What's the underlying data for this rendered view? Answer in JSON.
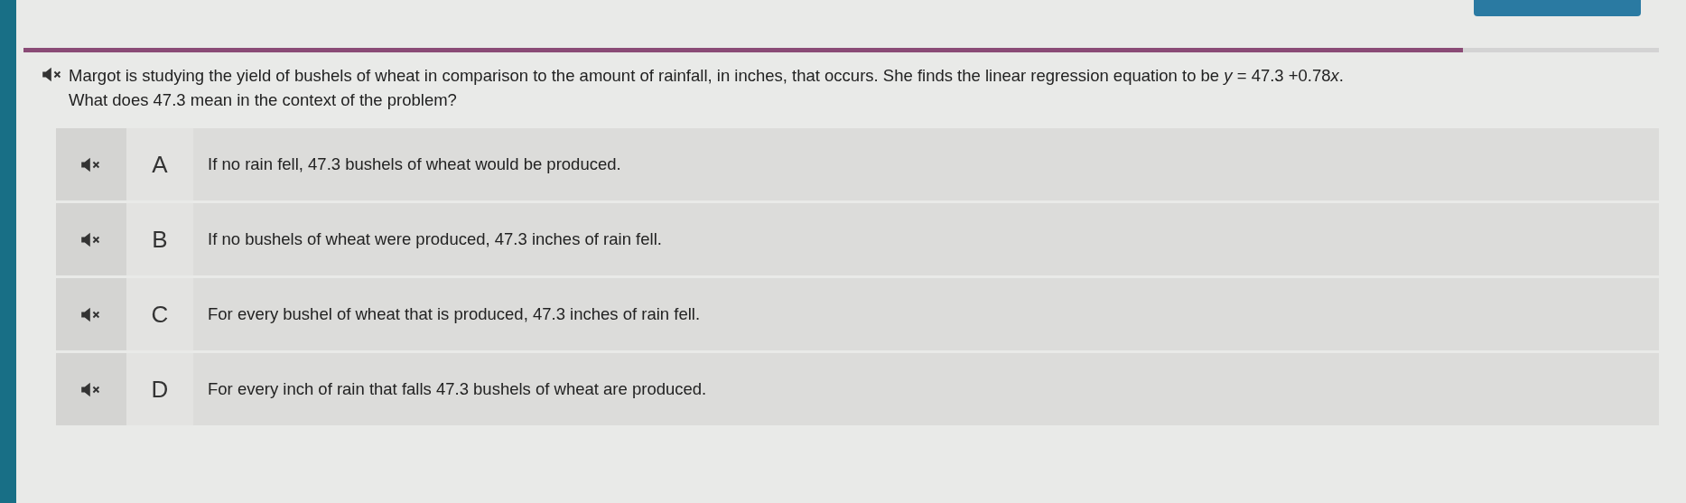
{
  "progress": {
    "level": 0.88
  },
  "question": {
    "lines": [
      [
        {
          "t": "Margot is studying the yield of bushels of wheat in comparison to the amount of rainfall, in inches, that occurs. She finds the linear regression equation to be ",
          "italic": false
        },
        {
          "t": "y",
          "italic": true
        },
        {
          "t": " = 47.3 +0.78",
          "italic": false
        },
        {
          "t": "x",
          "italic": true
        },
        {
          "t": ".",
          "italic": false
        }
      ],
      [
        {
          "t": "What does 47.3 mean in the context of the problem?",
          "italic": false
        }
      ]
    ]
  },
  "options": [
    {
      "letter": "A",
      "text": "If no rain fell, 47.3 bushels of wheat would be produced."
    },
    {
      "letter": "B",
      "text": "If no bushels of wheat were produced, 47.3 inches of rain fell."
    },
    {
      "letter": "C",
      "text": "For every bushel of wheat that is produced, 47.3 inches of rain fell."
    },
    {
      "letter": "D",
      "text": "For every inch of rain that falls 47.3 bushels of wheat are produced."
    }
  ]
}
